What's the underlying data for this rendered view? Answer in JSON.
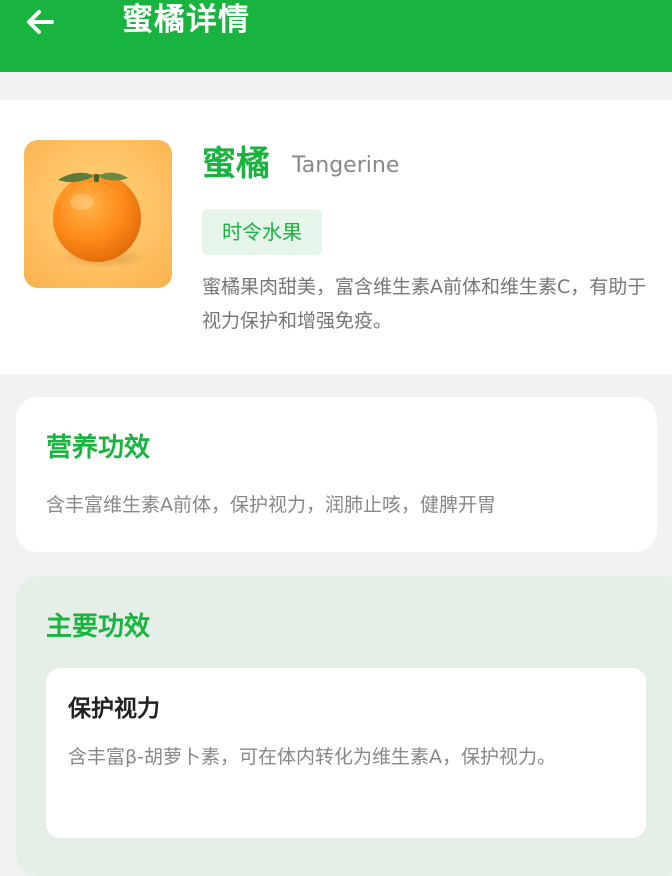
{
  "appbar": {
    "title": "蜜橘详情"
  },
  "fruit": {
    "name": "蜜橘",
    "english_name": "Tangerine",
    "tag": "时令水果",
    "description": "蜜橘果肉甜美，富含维生素A前体和维生素C，有助于视力保护和增强免疫。"
  },
  "nutrition": {
    "title": "营养功效",
    "text": "含丰富维生素A前体，保护视力，润肺止咳，健脾开胃"
  },
  "main_effects": {
    "title": "主要功效",
    "items": [
      {
        "title": "保护视力",
        "description": "含丰富β-胡萝卜素，可在体内转化为维生素A，保护视力。"
      }
    ]
  },
  "colors": {
    "primary": "#19b33f",
    "page_bg": "#f2f2f2",
    "tag_bg": "#e6f5e9",
    "effects_bg": "#e6efe7"
  }
}
